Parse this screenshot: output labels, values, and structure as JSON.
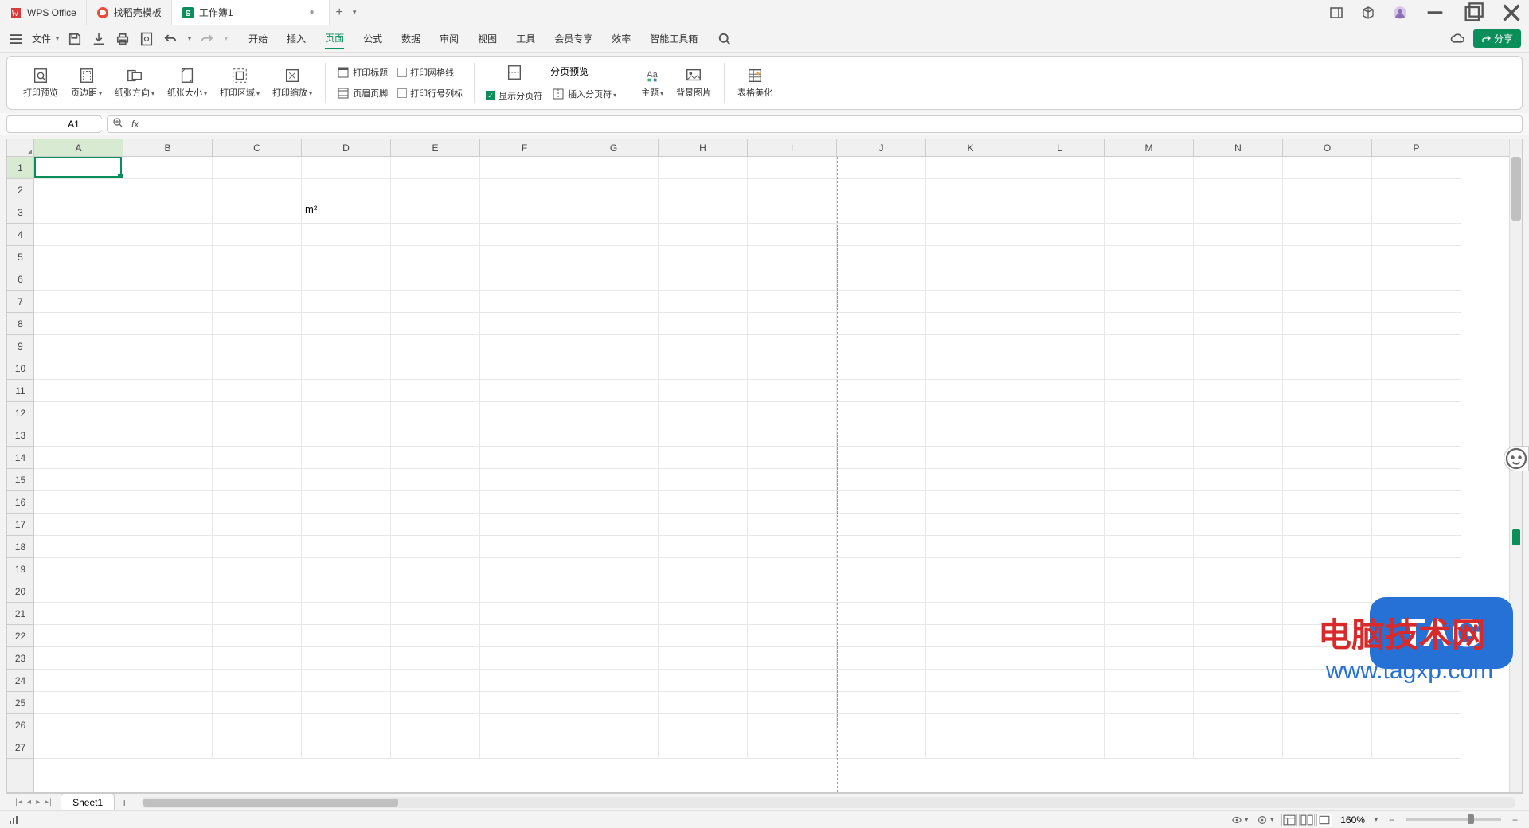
{
  "titlebar": {
    "tabs": [
      {
        "label": "WPS Office",
        "icon": "wps"
      },
      {
        "label": "找稻壳模板",
        "icon": "docer"
      },
      {
        "label": "工作簿1",
        "icon": "sheet",
        "active": true,
        "closable": true
      }
    ]
  },
  "menubar": {
    "file_label": "文件",
    "share_label": "分享",
    "tabs": [
      "开始",
      "插入",
      "页面",
      "公式",
      "数据",
      "审阅",
      "视图",
      "工具",
      "会员专享",
      "效率",
      "智能工具箱"
    ],
    "active_tab": "页面"
  },
  "ribbon": {
    "print_preview": "打印预览",
    "margins": "页边距",
    "orientation": "纸张方向",
    "size": "纸张大小",
    "print_area": "打印区域",
    "scale": "打印缩放",
    "print_title": "打印标题",
    "header_footer": "页眉页脚",
    "gridlines": "打印网格线",
    "line_numbers": "打印行号列标",
    "show_breaks": "显示分页符",
    "page_preview": "分页预览",
    "insert_break": "插入分页符",
    "theme": "主题",
    "background": "背景图片",
    "beautify": "表格美化"
  },
  "namebox": {
    "value": "A1"
  },
  "formula": {
    "fx_label": "fx",
    "value": ""
  },
  "grid": {
    "columns": [
      "A",
      "B",
      "C",
      "D",
      "E",
      "F",
      "G",
      "H",
      "I",
      "J",
      "K",
      "L",
      "M",
      "N",
      "O",
      "P"
    ],
    "row_count": 27,
    "active_cell": {
      "row": 1,
      "col": "A"
    },
    "cells": {
      "D3": "m²"
    },
    "page_break_after_col": "I"
  },
  "sheets": {
    "active": "Sheet1",
    "list": [
      "Sheet1"
    ]
  },
  "statusbar": {
    "zoom": "160%"
  },
  "watermark": {
    "text": "电脑技术网",
    "url": "www.tagxp.com",
    "tag": "TAG"
  }
}
